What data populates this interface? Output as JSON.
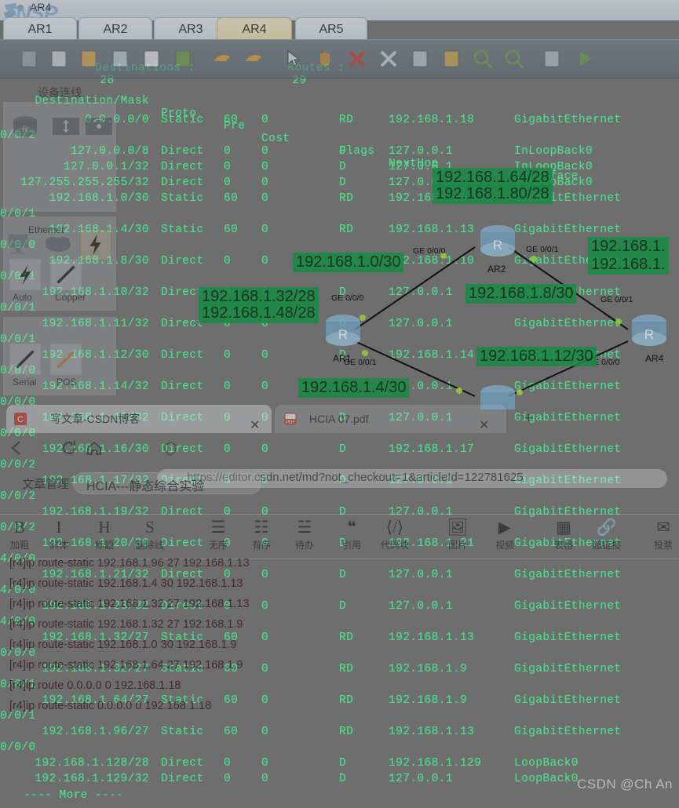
{
  "ensp": {
    "app_name": "eNSP",
    "window_title": "AR4",
    "tabs": [
      {
        "label": "AR1",
        "active": false
      },
      {
        "label": "AR2",
        "active": false
      },
      {
        "label": "AR3",
        "active": false
      },
      {
        "label": "AR4",
        "active": true
      },
      {
        "label": "AR5",
        "active": false
      }
    ],
    "toolbar_icons": [
      "new-topology-icon",
      "open-icon",
      "open-folder-icon",
      "save-icon",
      "save-as-icon",
      "print-icon",
      "undo-icon",
      "redo-icon",
      "select-cursor-icon",
      "pan-hand-icon",
      "delete-icon",
      "delete-link-icon",
      "comment-icon",
      "note-icon",
      "zoom-in-icon",
      "zoom-out-icon",
      "grid-icon",
      "start-all-icon"
    ],
    "device_panel": {
      "title": "设备连线",
      "section_labels": [
        "Ethernet",
        "Auto",
        "Copper",
        "Serial",
        "POS"
      ],
      "device_icons": [
        "router-icon",
        "switch-icon",
        "wireless-icon",
        "firewall-icon",
        "pc-icon",
        "cloud-icon",
        "lightning-link-icon"
      ]
    }
  },
  "cli": {
    "status": {
      "destinations_label": "Destinations :",
      "destinations_value": "28",
      "routes_label": "Routes :",
      "routes_value": "29"
    },
    "headers": [
      "Destination/Mask",
      "Proto",
      "Pre",
      "Cost",
      "Flags",
      "NextHop",
      "Interface"
    ],
    "rows": [
      {
        "dest": "0.0.0.0/0",
        "proto": "Static",
        "pre": "60",
        "cost": "0",
        "flags": "RD",
        "nexthop": "192.168.1.18",
        "iface": "GigabitEthernet",
        "cont": "0/0/2"
      },
      {
        "dest": "127.0.0.0/8",
        "proto": "Direct",
        "pre": "0",
        "cost": "0",
        "flags": "D",
        "nexthop": "127.0.0.1",
        "iface": "InLoopBack0",
        "cont": ""
      },
      {
        "dest": "127.0.0.1/32",
        "proto": "Direct",
        "pre": "0",
        "cost": "0",
        "flags": "D",
        "nexthop": "127.0.0.1",
        "iface": "InLoopBack0",
        "cont": ""
      },
      {
        "dest": "127.255.255.255/32",
        "proto": "Direct",
        "pre": "0",
        "cost": "0",
        "flags": "D",
        "nexthop": "127.0.0.1",
        "iface": "InLoopBack0",
        "cont": ""
      },
      {
        "dest": "192.168.1.0/30",
        "proto": "Static",
        "pre": "60",
        "cost": "0",
        "flags": "RD",
        "nexthop": "192.168.1.9",
        "iface": "GigabitEthernet",
        "cont": "0/0/1"
      },
      {
        "dest": "192.168.1.4/30",
        "proto": "Static",
        "pre": "60",
        "cost": "0",
        "flags": "RD",
        "nexthop": "192.168.1.13",
        "iface": "GigabitEthernet",
        "cont": "0/0/0"
      },
      {
        "dest": "192.168.1.8/30",
        "proto": "Direct",
        "pre": "0",
        "cost": "0",
        "flags": "D",
        "nexthop": "192.168.1.10",
        "iface": "GigabitEthernet",
        "cont": "0/0/1"
      },
      {
        "dest": "192.168.1.10/32",
        "proto": "Direct",
        "pre": "0",
        "cost": "0",
        "flags": "D",
        "nexthop": "127.0.0.1",
        "iface": "GigabitEthernet",
        "cont": "0/0/1"
      },
      {
        "dest": "192.168.1.11/32",
        "proto": "Direct",
        "pre": "0",
        "cost": "0",
        "flags": "D",
        "nexthop": "127.0.0.1",
        "iface": "GigabitEthernet",
        "cont": "0/0/1"
      },
      {
        "dest": "192.168.1.12/30",
        "proto": "Direct",
        "pre": "0",
        "cost": "0",
        "flags": "D",
        "nexthop": "192.168.1.14",
        "iface": "GigabitEthernet",
        "cont": "0/0/0"
      },
      {
        "dest": "192.168.1.14/32",
        "proto": "Direct",
        "pre": "0",
        "cost": "0",
        "flags": "D",
        "nexthop": "127.0.0.1",
        "iface": "GigabitEthernet",
        "cont": "0/0/0"
      },
      {
        "dest": "192.168.1.15/32",
        "proto": "Direct",
        "pre": "0",
        "cost": "0",
        "flags": "D",
        "nexthop": "127.0.0.1",
        "iface": "GigabitEthernet",
        "cont": "0/0/0"
      },
      {
        "dest": "192.168.1.16/30",
        "proto": "Direct",
        "pre": "0",
        "cost": "0",
        "flags": "D",
        "nexthop": "192.168.1.17",
        "iface": "GigabitEthernet",
        "cont": "0/0/2"
      },
      {
        "dest": "192.168.1.17/32",
        "proto": "Direct",
        "pre": "0",
        "cost": "0",
        "flags": "D",
        "nexthop": "127.0.0.1",
        "iface": "GigabitEthernet",
        "cont": "0/0/2"
      },
      {
        "dest": "192.168.1.19/32",
        "proto": "Direct",
        "pre": "0",
        "cost": "0",
        "flags": "D",
        "nexthop": "127.0.0.1",
        "iface": "GigabitEthernet",
        "cont": "0/0/2"
      },
      {
        "dest": "192.168.1.20/30",
        "proto": "Direct",
        "pre": "0",
        "cost": "0",
        "flags": "D",
        "nexthop": "192.168.1.21",
        "iface": "GigabitEthernet",
        "cont": "4/0/0"
      },
      {
        "dest": "192.168.1.21/32",
        "proto": "Direct",
        "pre": "0",
        "cost": "0",
        "flags": "D",
        "nexthop": "127.0.0.1",
        "iface": "GigabitEthernet",
        "cont": "4/0/0"
      },
      {
        "dest": "192.168.1.23/32",
        "proto": "Direct",
        "pre": "0",
        "cost": "0",
        "flags": "D",
        "nexthop": "127.0.0.1",
        "iface": "GigabitEthernet",
        "cont": "4/0/0"
      },
      {
        "dest": "192.168.1.32/27",
        "proto": "Static",
        "pre": "60",
        "cost": "0",
        "flags": "RD",
        "nexthop": "192.168.1.13",
        "iface": "GigabitEthernet",
        "cont": "0/0/0"
      },
      {
        "dest": "192.168.1.32/27",
        "proto": "Static",
        "pre": "60",
        "cost": "0",
        "flags": "RD",
        "nexthop": "192.168.1.9",
        "iface": "GigabitEthernet",
        "cont": "0/0/1"
      },
      {
        "dest": "192.168.1.64/27",
        "proto": "Static",
        "pre": "60",
        "cost": "0",
        "flags": "RD",
        "nexthop": "192.168.1.9",
        "iface": "GigabitEthernet",
        "cont": "0/0/1"
      },
      {
        "dest": "192.168.1.96/27",
        "proto": "Static",
        "pre": "60",
        "cost": "0",
        "flags": "RD",
        "nexthop": "192.168.1.13",
        "iface": "GigabitEthernet",
        "cont": "0/0/0"
      },
      {
        "dest": "192.168.1.128/28",
        "proto": "Direct",
        "pre": "0",
        "cost": "0",
        "flags": "D",
        "nexthop": "192.168.1.129",
        "iface": "LoopBack0",
        "cont": ""
      },
      {
        "dest": "192.168.1.129/32",
        "proto": "Direct",
        "pre": "0",
        "cost": "0",
        "flags": "D",
        "nexthop": "127.0.0.1",
        "iface": "LoopBack0",
        "cont": ""
      }
    ],
    "more_prompt": "---- More ----",
    "commands": [
      "[r4]ip route-static 192.168.1.96 27 192.168.1.13",
      "[r4]ip route-static 192.168.1.4 30 192.168.1.13",
      "[r4]ip route-static 192.168.1.32 27 192.168.1.13",
      "[r4]ip route-static 192.168.1.32 27 192.168.1.9",
      "[r4]ip route-static 192.168.1.0 30 192.168.1.9",
      "[r4]ip route-static 192.168.1.64 27 192.168.1.9",
      "[r4]ip route 0.0.0.0 0 192.168.1.18",
      "[r4]ip route-static 0.0.0.0 0 192.168.1.18"
    ]
  },
  "topology": {
    "routers": [
      {
        "name": "AR1"
      },
      {
        "name": "AR2"
      },
      {
        "name": "AR4"
      }
    ],
    "interface_labels": [
      "GE 0/0/0",
      "GE 0/0/1",
      "GE 0/0/0",
      "GE 0/0/1",
      "GE 0/0/1",
      "GE 0/0/0"
    ]
  },
  "annotations": [
    {
      "text": "192.168.1.0/30"
    },
    {
      "text": "192.168.1.32/28"
    },
    {
      "text": "192.168.1.48/28"
    },
    {
      "text": "192.168.1.64/28"
    },
    {
      "text": "192.168.1.80/28"
    },
    {
      "text": "192.168.1."
    },
    {
      "text": "192.168.1."
    },
    {
      "text": "192.168.1.8/30"
    },
    {
      "text": "192.168.1.12/30"
    },
    {
      "text": "192.168.1.4/30"
    }
  ],
  "browser": {
    "tabs": [
      {
        "title": "写文章-CSDN博客",
        "favicon": "csdn-icon",
        "active": true
      },
      {
        "title": "HCIA 07.pdf",
        "favicon": "pdf-icon",
        "active": false
      }
    ],
    "new_tab_label": "+",
    "close_label": "✕",
    "nav_icons": [
      "back-arrow-icon",
      "forward-arrow-icon",
      "reload-icon",
      "home-icon",
      "shield-icon"
    ],
    "url": "https://editor.csdn.net/md?not_checkout=1&articleId=122781625"
  },
  "csdn": {
    "breadcrumb": "文章管理",
    "article_title": "HCIA---静态综合实验",
    "toolbar": [
      {
        "glyph": "B",
        "label": "加粗",
        "name": "bold-button"
      },
      {
        "glyph": "I",
        "label": "斜体",
        "name": "italic-button"
      },
      {
        "glyph": "H",
        "label": "标题",
        "name": "heading-button"
      },
      {
        "glyph": "S",
        "label": "删除线",
        "name": "strikethrough-button"
      },
      {
        "glyph": "☰",
        "label": "无序",
        "name": "unordered-list-button"
      },
      {
        "glyph": "☷",
        "label": "有序",
        "name": "ordered-list-button"
      },
      {
        "glyph": "☱",
        "label": "待办",
        "name": "todo-list-button"
      },
      {
        "glyph": "❝",
        "label": "引用",
        "name": "quote-button"
      },
      {
        "glyph": "⟨/⟩",
        "label": "代码块",
        "name": "code-block-button"
      },
      {
        "glyph": "🖼",
        "label": "图片",
        "name": "image-button"
      },
      {
        "glyph": "▶",
        "label": "视频",
        "name": "video-button"
      },
      {
        "glyph": "▦",
        "label": "表格",
        "name": "table-button"
      },
      {
        "glyph": "🔗",
        "label": "超链接",
        "name": "hyperlink-button"
      },
      {
        "glyph": "✉",
        "label": "投票",
        "name": "vote-button"
      }
    ]
  },
  "watermark": "CSDN @Ch An"
}
